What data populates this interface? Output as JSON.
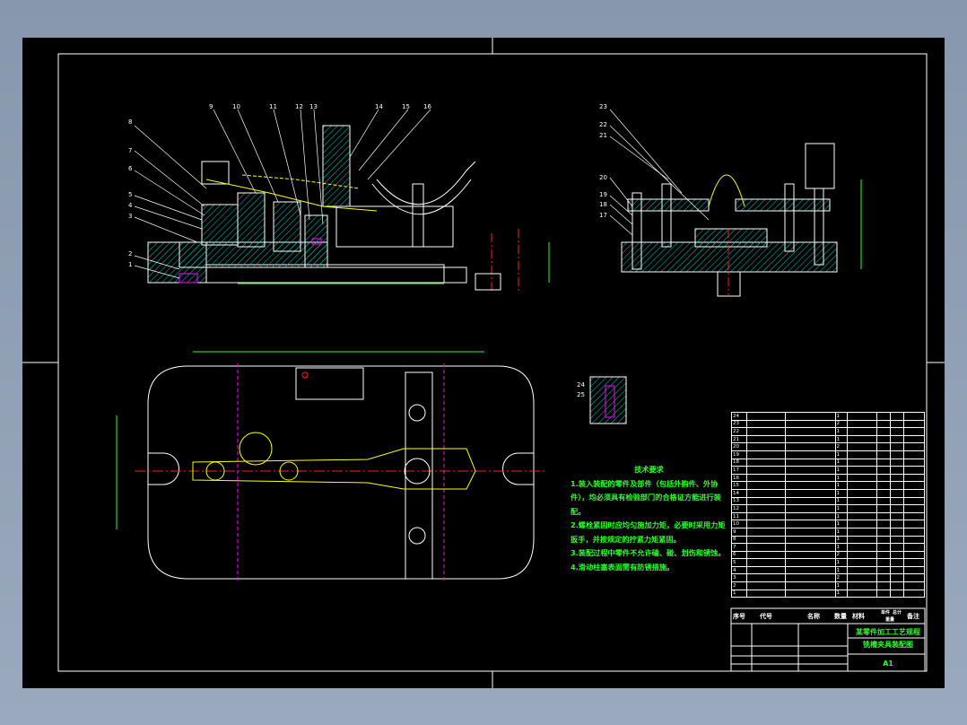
{
  "technical_requirements": {
    "heading": "技术要求",
    "items": [
      "1.装入装配的零件及部件（包括外购件、外协件），均必须具有检验部门的合格证方能进行装配。",
      "2.螺栓紧固时应均匀施加力矩，必要时采用力矩扳手，并按规定的拧紧力矩紧固。",
      "3.装配过程中零件不允许磕、碰、划伤和锈蚀。",
      "4.滑动柱塞表面需有防锈措施。"
    ]
  },
  "parts_list": {
    "headers": [
      "序号",
      "代号",
      "名称",
      "数量",
      "材料",
      "单件",
      "总计",
      "重量",
      "备注"
    ],
    "rows": [
      [
        "24",
        "",
        "",
        "1",
        ""
      ],
      [
        "23",
        "",
        "",
        "2",
        ""
      ],
      [
        "22",
        "",
        "",
        "1",
        ""
      ],
      [
        "21",
        "",
        "",
        "1",
        ""
      ],
      [
        "20",
        "",
        "",
        "2",
        ""
      ],
      [
        "19",
        "",
        "",
        "1",
        ""
      ],
      [
        "18",
        "",
        "",
        "1",
        ""
      ],
      [
        "17",
        "",
        "",
        "1",
        ""
      ],
      [
        "16",
        "",
        "",
        "1",
        ""
      ],
      [
        "15",
        "",
        "",
        "1",
        ""
      ],
      [
        "14",
        "",
        "",
        "1",
        ""
      ],
      [
        "13",
        "",
        "",
        "1",
        ""
      ],
      [
        "12",
        "",
        "",
        "1",
        ""
      ],
      [
        "11",
        "",
        "",
        "1",
        ""
      ],
      [
        "10",
        "",
        "",
        "1",
        ""
      ],
      [
        "9",
        "",
        "",
        "1",
        ""
      ],
      [
        "8",
        "",
        "",
        "1",
        ""
      ],
      [
        "7",
        "",
        "",
        "1",
        ""
      ],
      [
        "6",
        "",
        "",
        "2",
        ""
      ],
      [
        "5",
        "",
        "",
        "1",
        ""
      ],
      [
        "4",
        "",
        "",
        "1",
        ""
      ],
      [
        "3",
        "",
        "",
        "2",
        ""
      ],
      [
        "2",
        "",
        "",
        "1",
        ""
      ],
      [
        "1",
        "",
        "",
        "1",
        ""
      ]
    ]
  },
  "title_block": {
    "title": "某零件加工工艺规程",
    "drawing_name": "铣槽夹具装配图",
    "sheet_size": "A1"
  },
  "callouts_front": [
    "1",
    "2",
    "3",
    "4",
    "5",
    "6",
    "7",
    "8",
    "9",
    "10",
    "11",
    "12",
    "13",
    "14",
    "15",
    "16"
  ],
  "callouts_side": [
    "17",
    "18",
    "19",
    "20",
    "21",
    "22",
    "23"
  ],
  "callouts_detail": [
    "24",
    "25"
  ],
  "colors": {
    "sheet": "#000000",
    "lines": "#ffffff",
    "dimension": "#2bff2b",
    "yellow": "#ffff00",
    "centerline": "#ff2020",
    "magenta": "#ff00ff",
    "hatch": "#00c8c8"
  }
}
